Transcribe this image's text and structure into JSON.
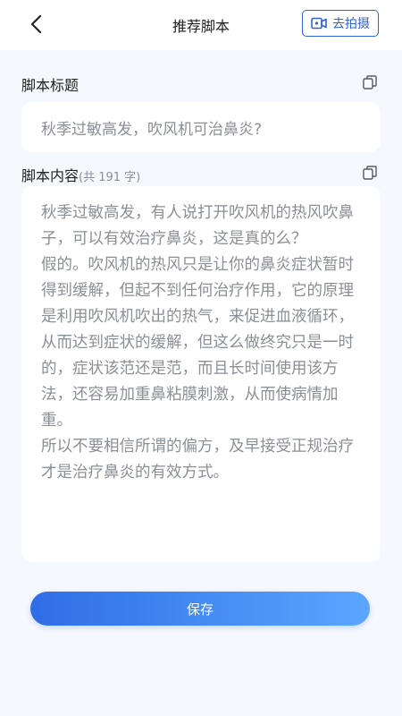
{
  "header": {
    "title": "推荐脚本",
    "shoot_label": "去拍摄"
  },
  "title_section": {
    "label": "脚本标题",
    "value": "秋季过敏高发，吹风机可治鼻炎?"
  },
  "content_section": {
    "label": "脚本内容",
    "count_text": "(共 191 字)",
    "value": "秋季过敏高发，有人说打开吹风机的热风吹鼻子，可以有效治疗鼻炎，这是真的么？\n假的。吹风机的热风只是让你的鼻炎症状暂时得到缓解，但起不到任何治疗作用，它的原理是利用吹风机吹出的热气，来促进血液循环，从而达到症状的缓解，但这么做终究只是一时的，症状该范还是范，而且长时间使用该方法，还容易加重鼻粘膜刺激，从而使病情加重。\n所以不要相信所谓的偏方，及早接受正规治疗才是治疗鼻炎的有效方式。"
  },
  "save_label": "保存",
  "colors": {
    "accent": "#2f63d8",
    "page_bg": "#f5f8fc"
  }
}
